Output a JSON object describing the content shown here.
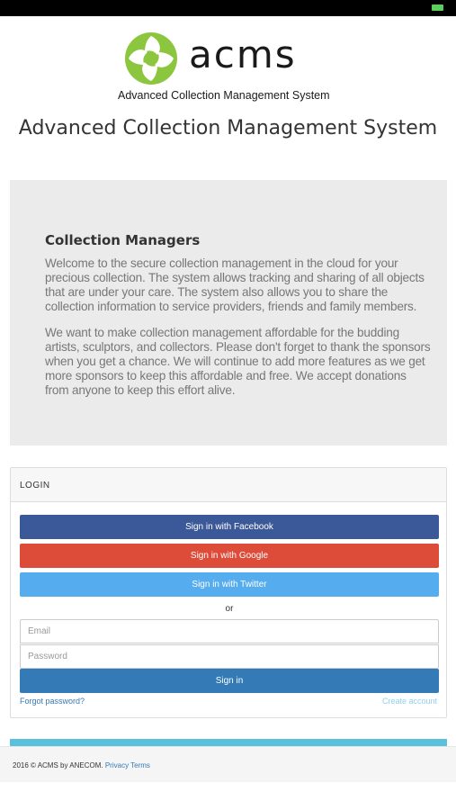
{
  "logo": {
    "wordmark": "acms",
    "tagline": "Advanced Collection Management System",
    "colors": {
      "green": "#8cc63f",
      "dark": "#1a1a1a"
    }
  },
  "app_title": "Advanced Collection Management System",
  "intro": {
    "heading": "Collection Managers",
    "paragraph1": "Welcome to the secure collection management in the cloud for your precious collection. The system allows tracking and sharing of all objects that are under your care. The system also allows you to share the collection information to service providers, friends and family members.",
    "paragraph2": "We want to make collection management affordable for the budding artists, sculptors, and collectors. Please don't forget to thank the sponsors when you get a chance. We will continue to add more features as we get more sponsors to keep this affordable and free. We accept donations from anyone to keep this effort alive."
  },
  "login": {
    "title": "LOGIN",
    "facebook_label": "Sign in with Facebook",
    "google_label": "Sign in with Google",
    "twitter_label": "Sign in with Twitter",
    "or_text": "or",
    "email_placeholder": "Email",
    "password_placeholder": "Password",
    "signin_label": "Sign in",
    "forgot_label": "Forgot password?",
    "create_label": "Create account",
    "colors": {
      "facebook": "#3b5998",
      "google": "#dd4b39",
      "twitter": "#55acee",
      "primary": "#337ab7"
    }
  },
  "footer": {
    "copyright": "2016 © ACMS by ANECOM.",
    "privacy_label": "Privacy",
    "terms_label": "Terms"
  }
}
